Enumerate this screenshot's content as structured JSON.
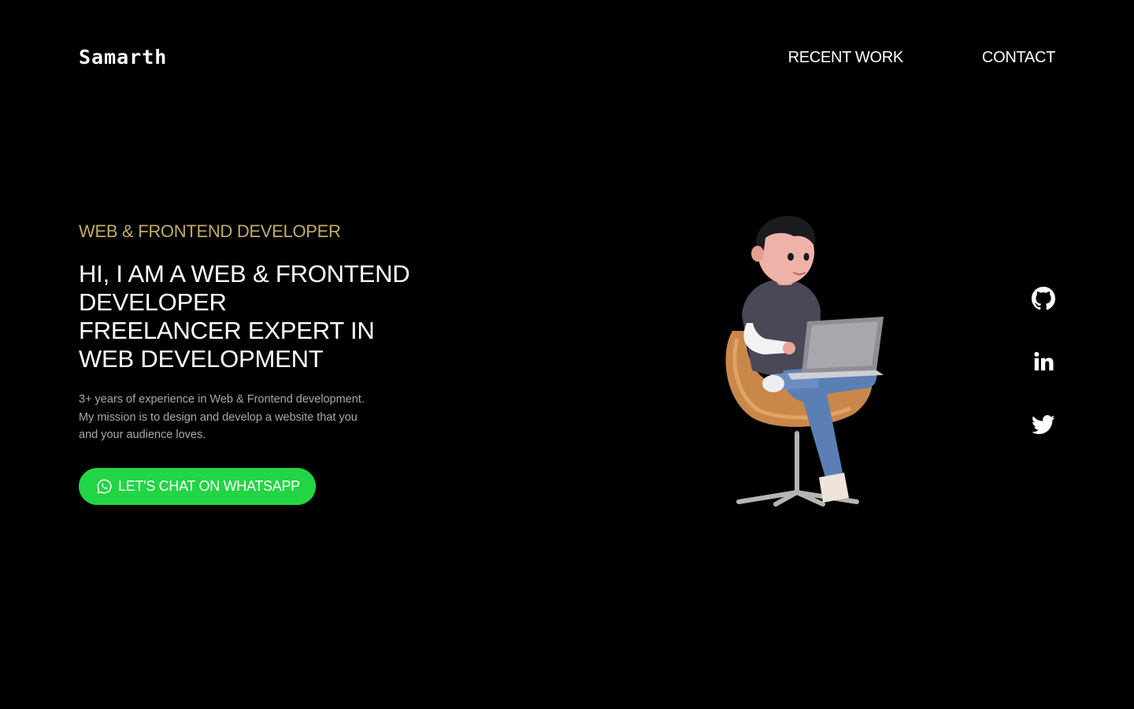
{
  "header": {
    "logo": "Samarth",
    "nav": [
      "RECENT WORK",
      "CONTACT"
    ]
  },
  "hero": {
    "subtitle": "WEB & FRONTEND DEVELOPER",
    "headline_lines": [
      "HI, I AM A WEB & FRONTEND",
      "DEVELOPER",
      "FREELANCER EXPERT IN",
      "WEB DEVELOPMENT"
    ],
    "description_lines": [
      "3+ years of experience in Web & Frontend development.",
      "My mission is to design and develop a website that you",
      "and your audience loves."
    ],
    "cta_label": "LET'S CHAT ON WHATSAPP",
    "cta_icon": "whatsapp-icon"
  },
  "social": [
    {
      "icon": "github-icon"
    },
    {
      "icon": "linkedin-icon"
    },
    {
      "icon": "twitter-icon"
    }
  ],
  "colors": {
    "background": "#000000",
    "accent_gold": "#c2ac63",
    "whatsapp_green": "#22d544",
    "description_gray": "#a9a9a9"
  }
}
